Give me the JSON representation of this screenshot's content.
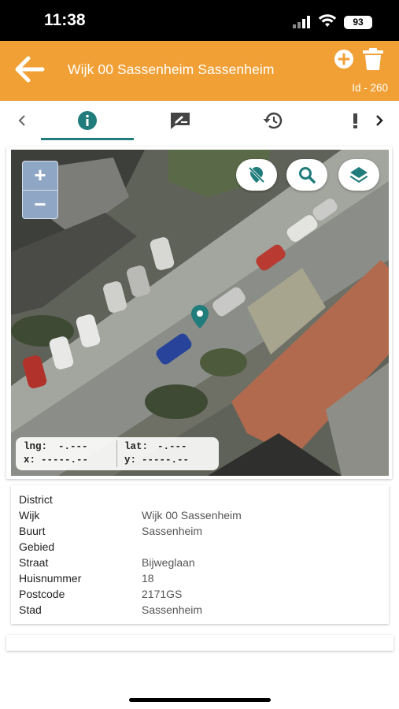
{
  "status": {
    "time": "11:38",
    "battery": "93"
  },
  "appbar": {
    "title": "Wijk 00 Sassenheim Sassenheim",
    "id_label": "Id - 260",
    "color": "#f0a035"
  },
  "tabs": [
    {
      "icon": "info-icon",
      "active": true
    },
    {
      "icon": "edit-note-icon",
      "active": false
    },
    {
      "icon": "history-icon",
      "active": false
    },
    {
      "icon": "alert-icon",
      "active": false
    }
  ],
  "map": {
    "zoom_in": "+",
    "zoom_out": "−",
    "coords": {
      "lng_label": "lng:",
      "lng_value": "-.---",
      "lat_label": "lat:",
      "lat_value": "-.---",
      "x_label": "x:",
      "x_value": "-----.--",
      "y_label": "y:",
      "y_value": "-----.--"
    }
  },
  "details": {
    "rows": [
      {
        "label": "District",
        "value": ""
      },
      {
        "label": "Wijk",
        "value": "Wijk 00 Sassenheim"
      },
      {
        "label": "Buurt",
        "value": "Sassenheim"
      },
      {
        "label": "Gebied",
        "value": ""
      },
      {
        "label": "Straat",
        "value": "Bijweglaan"
      },
      {
        "label": "Huisnummer",
        "value": "18"
      },
      {
        "label": "Postcode",
        "value": "2171GS"
      },
      {
        "label": "Stad",
        "value": "Sassenheim"
      }
    ]
  }
}
